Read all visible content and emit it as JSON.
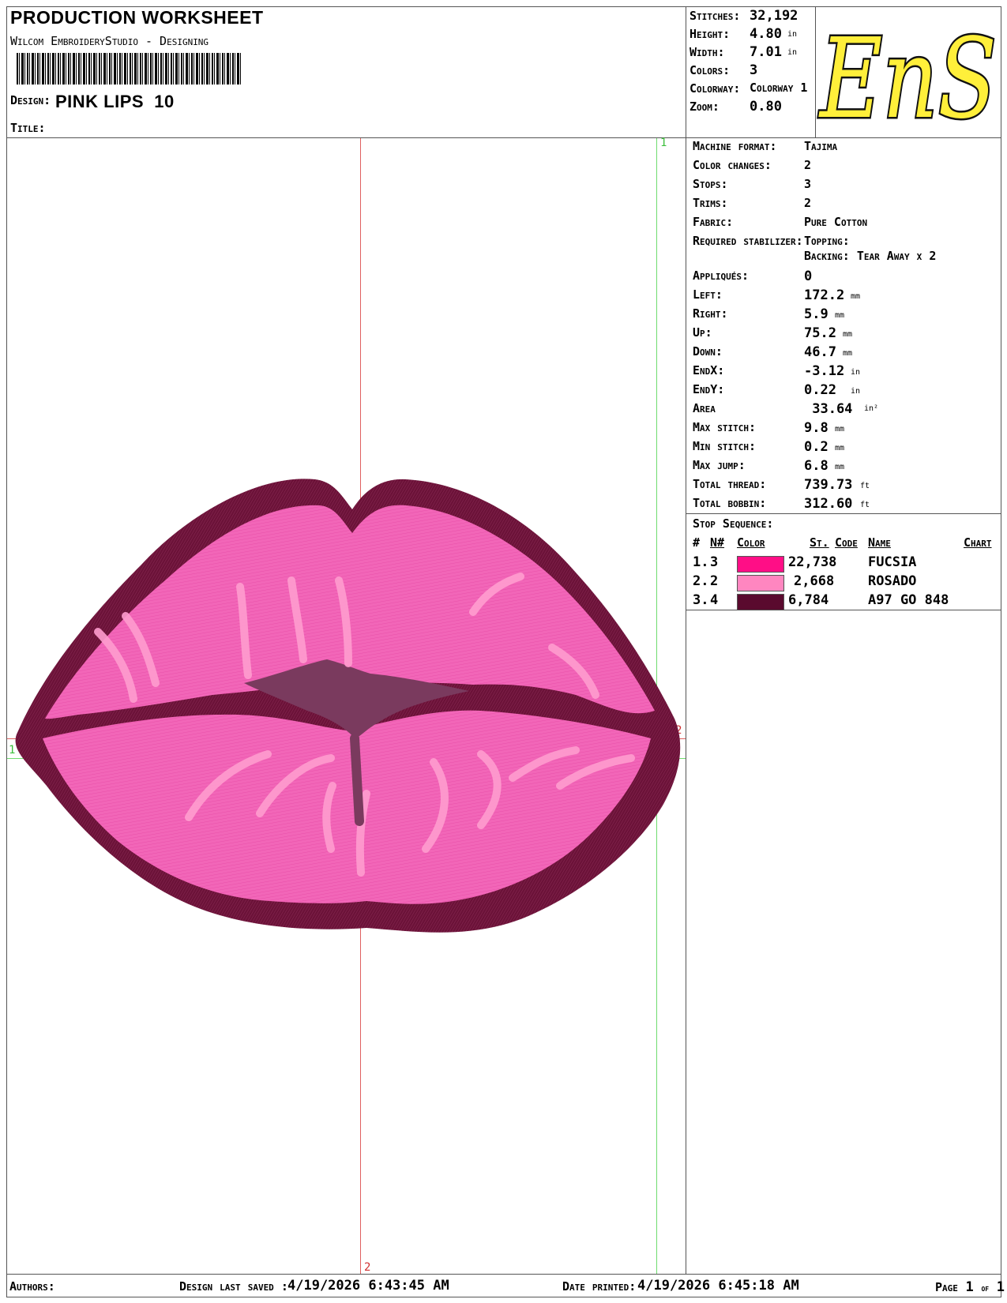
{
  "header": {
    "title": "PRODUCTION WORKSHEET",
    "software": "Wilcom EmbroideryStudio - Designing",
    "design_label": "Design:",
    "design_name": "PINK LIPS  10",
    "title_label": "Title:"
  },
  "summary": {
    "stitches_label": "Stitches:",
    "stitches": "32,192",
    "height_label": "Height:",
    "height": "4.80",
    "height_unit": "in",
    "width_label": "Width:",
    "width": "7.01",
    "width_unit": "in",
    "colors_label": "Colors:",
    "colors": "3",
    "colorway_label": "Colorway:",
    "colorway": "Colorway 1",
    "zoom_label": "Zoom:",
    "zoom": "0.80"
  },
  "logo": {
    "text": "EnS",
    "fill": "#ffef3a",
    "stroke": "#111111"
  },
  "specs": [
    {
      "label": "Machine format:",
      "value": "Tajima",
      "unit": ""
    },
    {
      "label": "Color changes:",
      "value": "2",
      "unit": ""
    },
    {
      "label": "Stops:",
      "value": "3",
      "unit": ""
    },
    {
      "label": "Trims:",
      "value": "2",
      "unit": ""
    },
    {
      "label": "Fabric:",
      "value": "Pure Cotton",
      "unit": ""
    }
  ],
  "stabilizer": {
    "label": "Required stabilizer:",
    "topping": "Topping:",
    "backing": "Backing: Tear Away x 2"
  },
  "specs2": [
    {
      "label": "Appliqués:",
      "value": "0",
      "unit": ""
    },
    {
      "label": "Left:",
      "value": "172.2",
      "unit": "mm"
    },
    {
      "label": "Right:",
      "value": "5.9",
      "unit": "mm"
    },
    {
      "label": "Up:",
      "value": "75.2",
      "unit": "mm"
    },
    {
      "label": "Down:",
      "value": "46.7",
      "unit": "mm"
    },
    {
      "label": "EndX:",
      "value": "-3.12",
      "unit": "in"
    },
    {
      "label": "EndY:",
      "value": "0.22",
      "unit": "in"
    },
    {
      "label": "Area",
      "value": " 33.64",
      "unit": "in²"
    },
    {
      "label": "Max stitch:",
      "value": "9.8",
      "unit": "mm"
    },
    {
      "label": "Min stitch:",
      "value": "0.2",
      "unit": "mm"
    },
    {
      "label": "Max jump:",
      "value": "6.8",
      "unit": "mm"
    },
    {
      "label": "Total thread:",
      "value": "739.73",
      "unit": "ft"
    },
    {
      "label": "Total bobbin:",
      "value": "312.60",
      "unit": "ft"
    }
  ],
  "stop_sequence": {
    "title": "Stop Sequence:",
    "headers": {
      "num": "#",
      "n": "N#",
      "color": "Color",
      "st": "St.",
      "code": "Code",
      "name": "Name",
      "chart": "Chart"
    },
    "rows": [
      {
        "num": "1.",
        "n": "3",
        "color": "#ff0e86",
        "st": "22,738",
        "name": "FUCSIA"
      },
      {
        "num": "2.",
        "n": "2",
        "color": "#ff86c0",
        "st": "2,668",
        "name": "ROSADO"
      },
      {
        "num": "3.",
        "n": "4",
        "color": "#5a0a2e",
        "st": "6,784",
        "name": "A97 GO 848"
      }
    ]
  },
  "guides": {
    "green_top": "1",
    "green_left": "1",
    "red_right": "2",
    "red_bottom": "2",
    "green_color": "#6fdc6f",
    "red_color": "#e06060"
  },
  "design_colors": {
    "main": "#f266b8",
    "light": "#ff9dcf",
    "dark": "#6b1238",
    "mouth": "#7a3a5e"
  },
  "footer": {
    "authors_label": "Authors:",
    "saved_label": "Design last saved :",
    "saved": "4/19/2026 6:43:45 AM",
    "printed_label": "Date printed:",
    "printed": "4/19/2026 6:45:18 AM",
    "page_label": "Page",
    "page": "1",
    "of_label": "of",
    "pages": "1"
  }
}
